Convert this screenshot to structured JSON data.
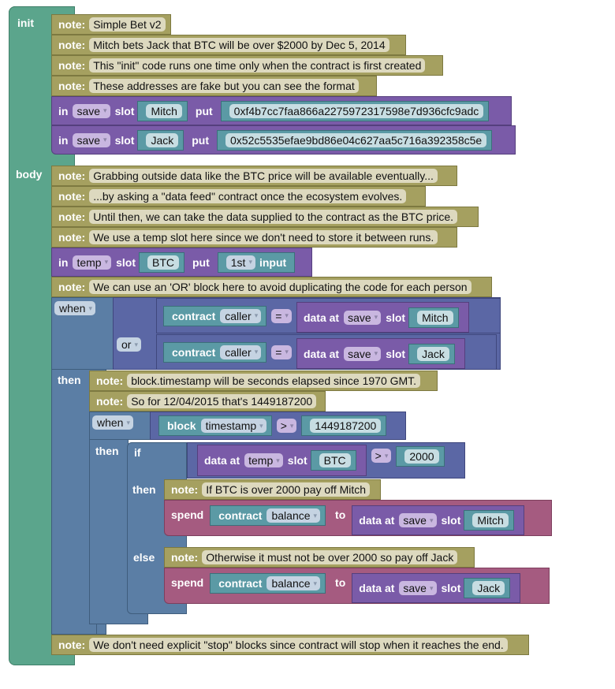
{
  "init": {
    "label": "init",
    "notes": [
      "Simple Bet v2",
      "Mitch bets Jack that BTC will be over $2000 by Dec 5, 2014",
      "This \"init\" code runs one time only when the contract is first created",
      "These addresses are fake but you can see the format"
    ],
    "stores": [
      {
        "in": "in",
        "store": "save",
        "slot_kw": "slot",
        "slot": "Mitch",
        "put": "put",
        "value": "0xf4b7cc7faa866a2275972317598e7d936cfc9adc"
      },
      {
        "in": "in",
        "store": "save",
        "slot_kw": "slot",
        "slot": "Jack",
        "put": "put",
        "value": "0x52c5535efae9bd86e04c627aa5c716a392358c5e"
      }
    ]
  },
  "body": {
    "label": "body",
    "notes": [
      "Grabbing outside data like the BTC price will be available eventually...",
      "...by asking a \"data feed\" contract once the ecosystem evolves.",
      "Until then, we can take the data supplied to the contract as the BTC price.",
      "We use a temp slot here since we don't need to store it between runs."
    ],
    "temp_store": {
      "in": "in",
      "store": "temp",
      "slot_kw": "slot",
      "slot": "BTC",
      "put": "put",
      "input_index": "1st",
      "input_kw": "input"
    },
    "or_note": "We can use an 'OR' block here to avoid duplicating the code for each person",
    "when": {
      "when_label": "when",
      "or_label": "or",
      "then_label": "then",
      "conditions": [
        {
          "contract": "contract",
          "prop": "caller",
          "op": "=",
          "data_at": "data at",
          "store": "save",
          "slot_kw": "slot",
          "slot": "Mitch"
        },
        {
          "contract": "contract",
          "prop": "caller",
          "op": "=",
          "data_at": "data at",
          "store": "save",
          "slot_kw": "slot",
          "slot": "Jack"
        }
      ],
      "notes": [
        "block.timestamp will be seconds elapsed since 1970 GMT.",
        "So for 12/04/2015 that's 1449187200"
      ],
      "inner_when": {
        "when_label": "when",
        "then_label": "then",
        "block": "block",
        "prop": "timestamp",
        "op": ">",
        "value": "1449187200",
        "if": {
          "if_label": "if",
          "then_label": "then",
          "else_label": "else",
          "cond": {
            "data_at": "data at",
            "store": "temp",
            "slot_kw": "slot",
            "slot": "BTC",
            "op": ">",
            "value": "2000"
          },
          "then_note": "If BTC is over 2000 pay off Mitch",
          "then_spend": {
            "spend": "spend",
            "contract": "contract",
            "prop": "balance",
            "to": "to",
            "data_at": "data at",
            "store": "save",
            "slot_kw": "slot",
            "slot": "Mitch"
          },
          "else_note": "Otherwise it must not be over 2000 so pay off Jack",
          "else_spend": {
            "spend": "spend",
            "contract": "contract",
            "prop": "balance",
            "to": "to",
            "data_at": "data at",
            "store": "save",
            "slot_kw": "slot",
            "slot": "Jack"
          }
        }
      }
    },
    "end_note": "We don't need explicit \"stop\" blocks since contract will stop when it reaches the end."
  },
  "note_kw": "note:",
  "caret": "▾"
}
